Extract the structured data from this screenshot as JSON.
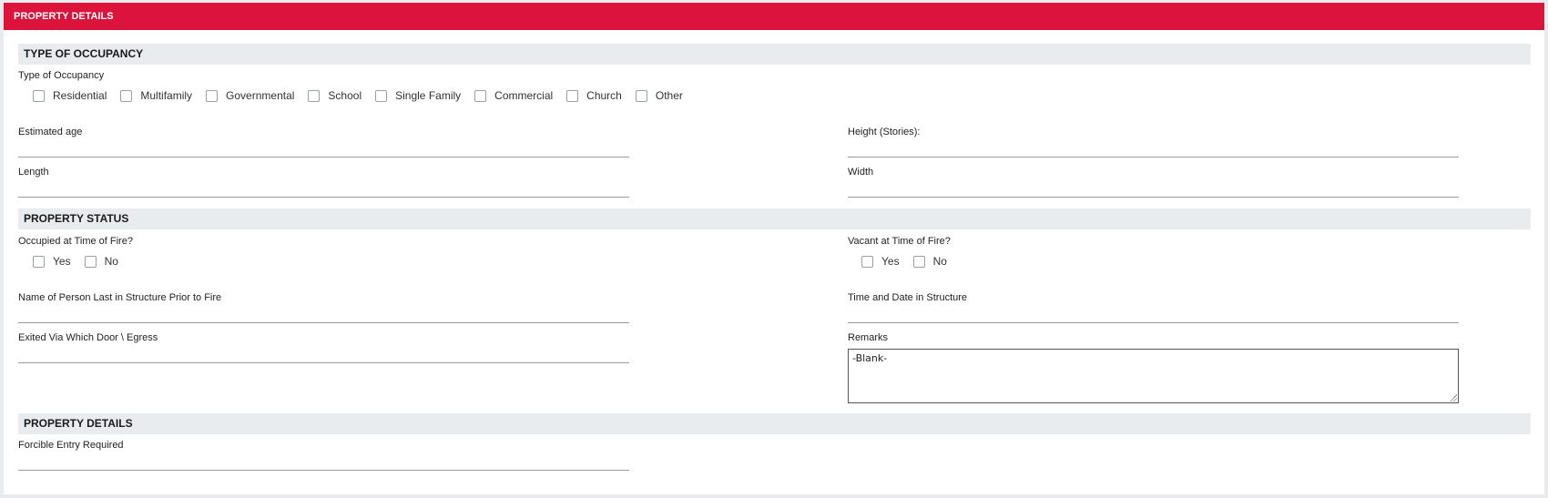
{
  "header": {
    "title": "PROPERTY DETAILS"
  },
  "sections": {
    "occupancy": "TYPE OF OCCUPANCY",
    "status": "PROPERTY STATUS",
    "details": "PROPERTY DETAILS"
  },
  "occupancy": {
    "label": "Type of Occupancy",
    "options": [
      "Residential",
      "Multifamily",
      "Governmental",
      "School",
      "Single Family",
      "Commercial",
      "Church",
      "Other"
    ]
  },
  "fields": {
    "estimated_age": "Estimated age",
    "height": "Height (Stories):",
    "length": "Length",
    "width": "Width",
    "occupied": "Occupied at Time of Fire?",
    "vacant": "Vacant at Time of Fire?",
    "last_person": "Name of Person Last in Structure Prior to Fire",
    "time_date": "Time and Date in Structure",
    "exited": "Exited Via Which Door \\ Egress",
    "remarks": "Remarks",
    "forcible": "Forcible Entry Required"
  },
  "yes_no": {
    "yes": "Yes",
    "no": "No"
  },
  "remarks_value": "-Blank-"
}
